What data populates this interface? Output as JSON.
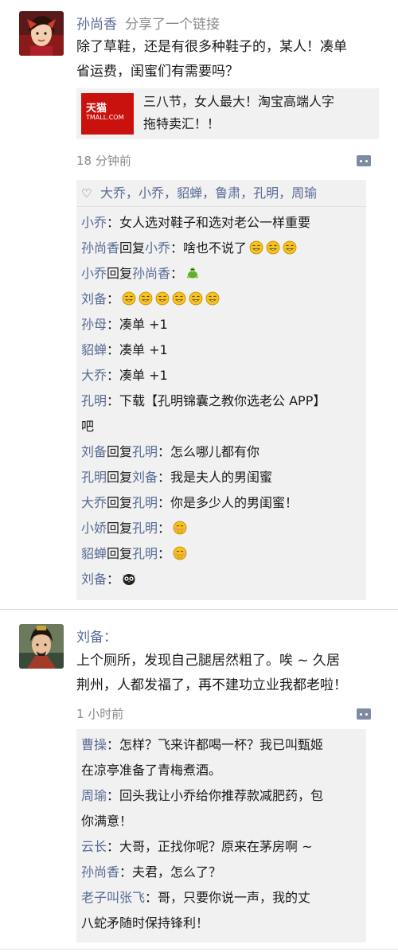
{
  "post1": {
    "author": "孙尚香",
    "action": "分享了一个链接",
    "text_line1": "除了草鞋，还是有很多种鞋子的，某人！凑单",
    "text_line2": "省运费，闺蜜们有需要吗？",
    "link": {
      "logo_cn": "天猫",
      "logo_en": "TMALL.COM",
      "title_line1": "三八节，女人最大！淘宝高端人字",
      "title_line2": "拖特卖汇！！"
    },
    "time": "18 分钟前",
    "likes": [
      "大乔",
      "小乔",
      "貂蝉",
      "鲁肃",
      "孔明",
      "周瑜"
    ],
    "like_sep": "，",
    "comments": [
      {
        "from": "小乔",
        "to": "",
        "text": "：女人选对鞋子和选对老公一样重要",
        "emoji": []
      },
      {
        "from": "孙尚香",
        "to": "小乔",
        "text": "：啥也不说了",
        "emoji": [
          "grin",
          "grin",
          "grin"
        ]
      },
      {
        "from": "小乔",
        "to": "孙尚香",
        "text": "：",
        "emoji": [
          "turtle"
        ]
      },
      {
        "from": "刘备",
        "to": "",
        "text": "：",
        "emoji": [
          "grin",
          "grin",
          "grin",
          "grin",
          "grin",
          "grin"
        ]
      },
      {
        "from": "孙母",
        "to": "",
        "text": "：凑单 +1",
        "emoji": []
      },
      {
        "from": "貂蝉",
        "to": "",
        "text": "：凑单 +1",
        "emoji": []
      },
      {
        "from": "大乔",
        "to": "",
        "text": "：凑单 +1",
        "emoji": []
      },
      {
        "from": "孔明",
        "to": "",
        "text": "：下载【孔明锦囊之教你选老公 APP】",
        "text2": "吧",
        "emoji": []
      },
      {
        "from": "刘备",
        "to": "孔明",
        "text": "：怎么哪儿都有你",
        "emoji": []
      },
      {
        "from": "孔明",
        "to": "刘备",
        "text": "：我是夫人的男闺蜜",
        "emoji": []
      },
      {
        "from": "大乔",
        "to": "孔明",
        "text": "：你是多少人的男闺蜜！",
        "emoji": []
      },
      {
        "from": "小娇",
        "to": "孔明",
        "text": "：",
        "emoji": [
          "shy"
        ]
      },
      {
        "from": "貂蝉",
        "to": "孔明",
        "text": "：",
        "emoji": [
          "shy"
        ]
      },
      {
        "from": "刘备",
        "to": "",
        "text": "：",
        "emoji": [
          "owl"
        ]
      }
    ],
    "reply_word": "回复"
  },
  "post2": {
    "author": "刘备",
    "author_suffix": "：",
    "text_line1": "上个厕所，发现自己腿居然粗了。唉 ~ 久居",
    "text_line2": "荆州，人都发福了，再不建功立业我都老啦！",
    "time": "1 小时前",
    "comments": [
      {
        "from": "曹操",
        "text": "：怎样？飞来许都喝一杯？我已叫甄姬",
        "text2": "在凉亭准备了青梅煮酒。"
      },
      {
        "from": "周瑜",
        "text": "：回头我让小乔给你推荐款减肥药，包",
        "text2": "你满意！"
      },
      {
        "from": "云长",
        "text": "：大哥，正找你呢？原来在茅房啊 ~",
        "text2": ""
      },
      {
        "from": "孙尚香",
        "text": "：夫君，怎么了？",
        "text2": ""
      },
      {
        "from": "老子叫张飞",
        "text": "：哥，只要你说一声，我的丈",
        "text2": "八蛇矛随时保持锋利！"
      }
    ]
  },
  "icons": {
    "like": "heart-icon",
    "comment": "comment-icon",
    "link_thumb": "tmall-logo"
  },
  "colors": {
    "name_blue": "#576b95",
    "meta_gray": "#8a8a8a",
    "panel_bg": "#f1f1f1",
    "tmall_red": "#c9120d"
  }
}
